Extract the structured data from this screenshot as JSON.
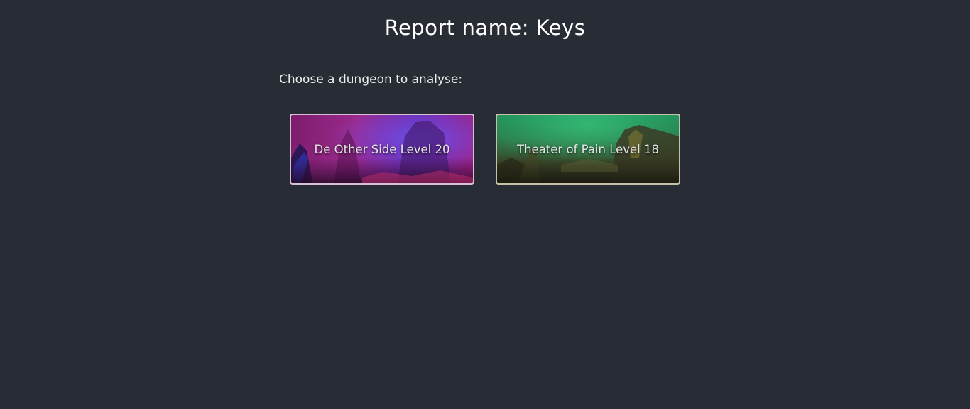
{
  "header": {
    "title": "Report name: Keys"
  },
  "main": {
    "prompt": "Choose a dungeon to analyse:",
    "dungeons": [
      {
        "label": "De Other Side Level 20",
        "accent": "#9b2a8e"
      },
      {
        "label": "Theater of Pain Level 18",
        "accent": "#1f8d5a"
      }
    ]
  },
  "colors": {
    "background": "#282c35",
    "text": "#ffffff"
  }
}
